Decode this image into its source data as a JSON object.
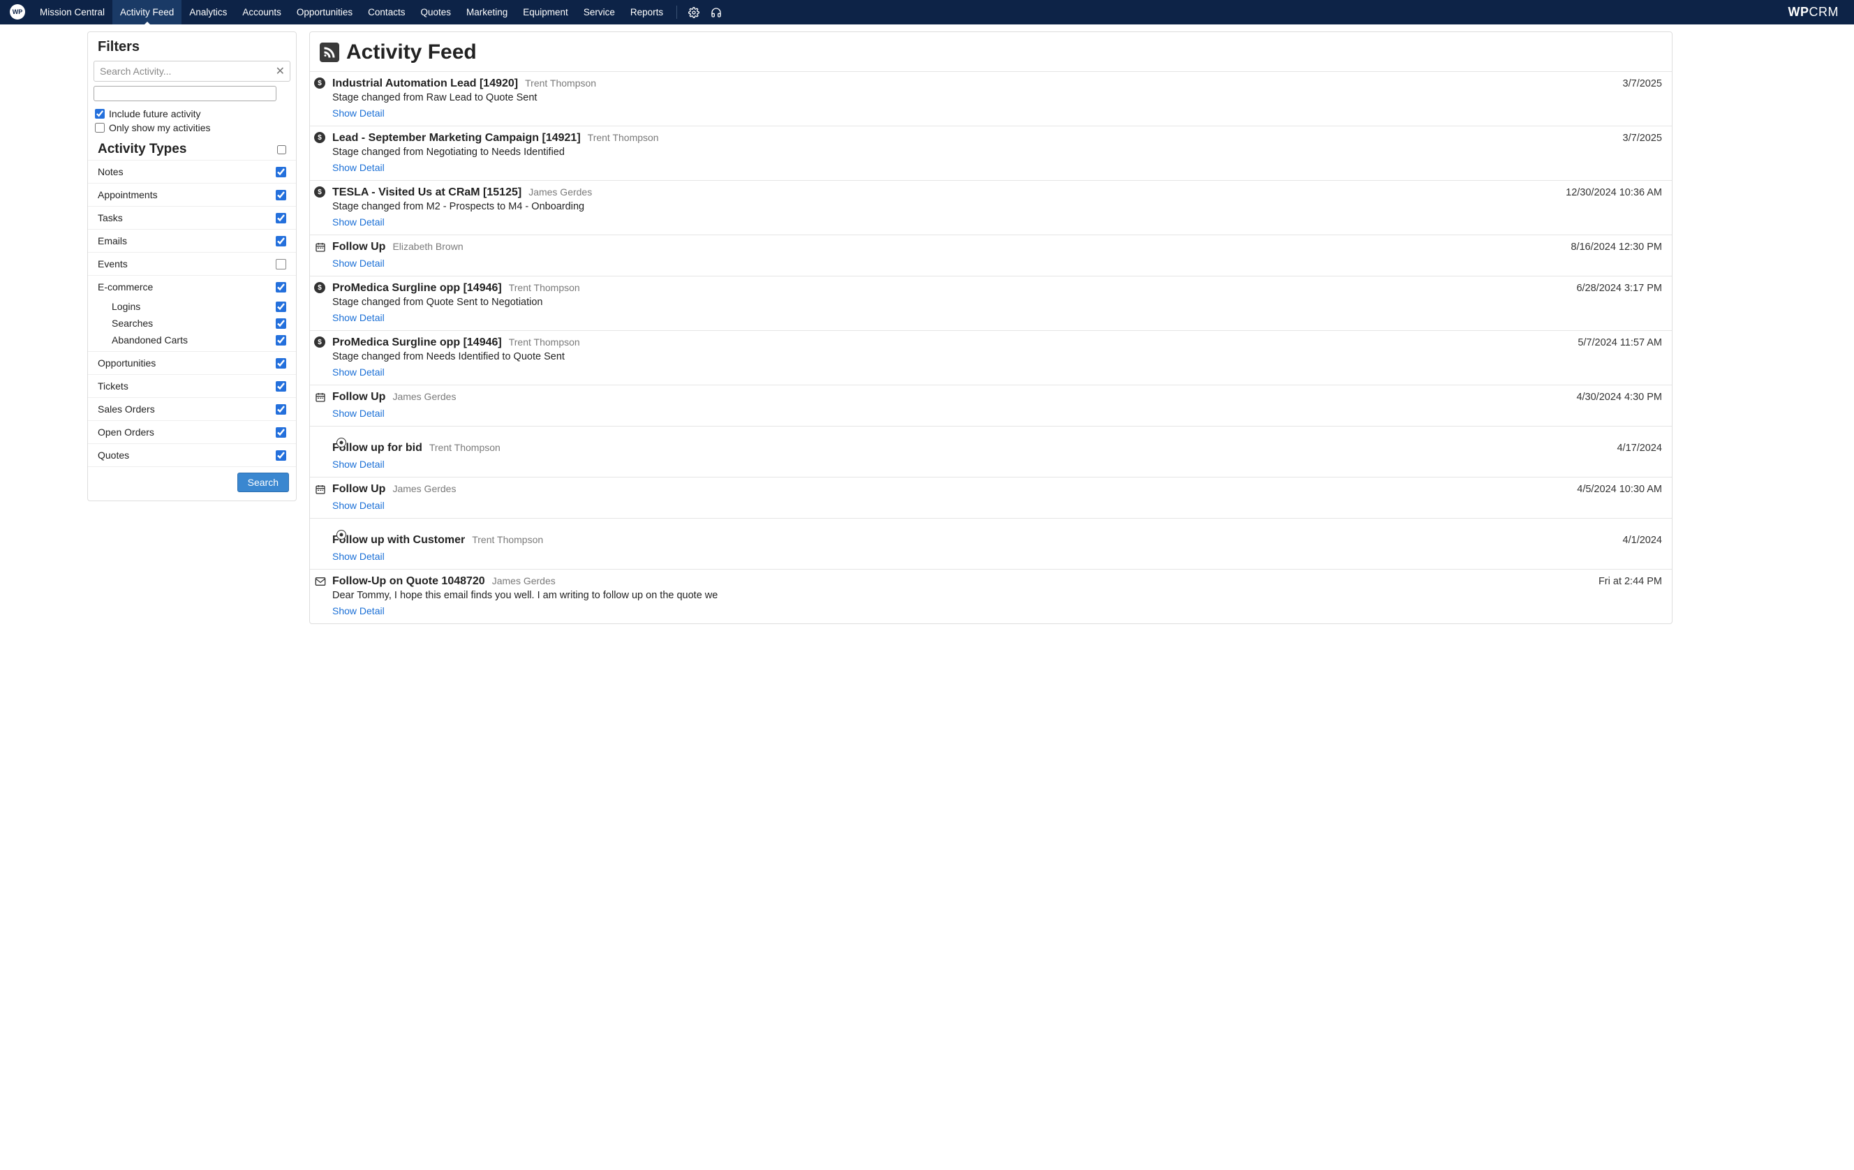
{
  "nav": {
    "brand_prefix": "WP",
    "brand_suffix": "CRM",
    "items": [
      "Mission Central",
      "Activity Feed",
      "Analytics",
      "Accounts",
      "Opportunities",
      "Contacts",
      "Quotes",
      "Marketing",
      "Equipment",
      "Service",
      "Reports"
    ],
    "active_index": 1
  },
  "filters": {
    "header": "Filters",
    "search_placeholder": "Search Activity...",
    "include_future_label": "Include future activity",
    "include_future_checked": true,
    "only_mine_label": "Only show my activities",
    "only_mine_checked": false,
    "types_header": "Activity Types",
    "types_master_checked": false,
    "types": [
      {
        "label": "Notes",
        "checked": true
      },
      {
        "label": "Appointments",
        "checked": true
      },
      {
        "label": "Tasks",
        "checked": true
      },
      {
        "label": "Emails",
        "checked": true
      },
      {
        "label": "Events",
        "checked": false
      },
      {
        "label": "E-commerce",
        "checked": true,
        "children": [
          {
            "label": "Logins",
            "checked": true
          },
          {
            "label": "Searches",
            "checked": true
          },
          {
            "label": "Abandoned Carts",
            "checked": true
          }
        ]
      },
      {
        "label": "Opportunities",
        "checked": true
      },
      {
        "label": "Tickets",
        "checked": true
      },
      {
        "label": "Sales Orders",
        "checked": true
      },
      {
        "label": "Open Orders",
        "checked": true
      },
      {
        "label": "Quotes",
        "checked": true
      }
    ],
    "search_button": "Search"
  },
  "feed": {
    "title": "Activity Feed",
    "show_detail_label": "Show Detail",
    "items": [
      {
        "icon": "dollar",
        "subject": "Industrial Automation Lead [14920]",
        "user": "Trent Thompson",
        "date": "3/7/2025",
        "desc": "Stage changed from Raw Lead to Quote Sent"
      },
      {
        "icon": "dollar",
        "subject": "Lead - September Marketing Campaign [14921]",
        "user": "Trent Thompson",
        "date": "3/7/2025",
        "desc": "Stage changed from Negotiating to Needs Identified"
      },
      {
        "icon": "dollar",
        "subject": "TESLA - Visited Us at CRaM [15125]",
        "user": "James Gerdes",
        "date": "12/30/2024 10:36 AM",
        "desc": "Stage changed from M2 - Prospects to M4 - Onboarding"
      },
      {
        "icon": "calendar",
        "subject": "Follow Up",
        "user": "Elizabeth Brown",
        "date": "8/16/2024 12:30 PM",
        "desc": ""
      },
      {
        "icon": "dollar",
        "subject": "ProMedica Surgline opp [14946]",
        "user": "Trent Thompson",
        "date": "6/28/2024 3:17 PM",
        "desc": "Stage changed from Quote Sent to Negotiation"
      },
      {
        "icon": "dollar",
        "subject": "ProMedica Surgline opp [14946]",
        "user": "Trent Thompson",
        "date": "5/7/2024 11:57 AM",
        "desc": "Stage changed from Needs Identified to Quote Sent"
      },
      {
        "icon": "calendar",
        "subject": "Follow Up",
        "user": "James Gerdes",
        "date": "4/30/2024 4:30 PM",
        "desc": ""
      },
      {
        "icon": "target",
        "subject": "Follow up for bid",
        "user": "Trent Thompson",
        "date": "4/17/2024",
        "desc": ""
      },
      {
        "icon": "calendar",
        "subject": "Follow Up",
        "user": "James Gerdes",
        "date": "4/5/2024 10:30 AM",
        "desc": ""
      },
      {
        "icon": "target",
        "subject": "Follow up with Customer",
        "user": "Trent Thompson",
        "date": "4/1/2024",
        "desc": ""
      },
      {
        "icon": "mail",
        "subject": "Follow-Up on Quote 1048720",
        "user": "James Gerdes",
        "date": "Fri at 2:44 PM",
        "desc": "Dear Tommy, I hope this email finds you well. I am writing to follow up on the quote we"
      }
    ]
  }
}
